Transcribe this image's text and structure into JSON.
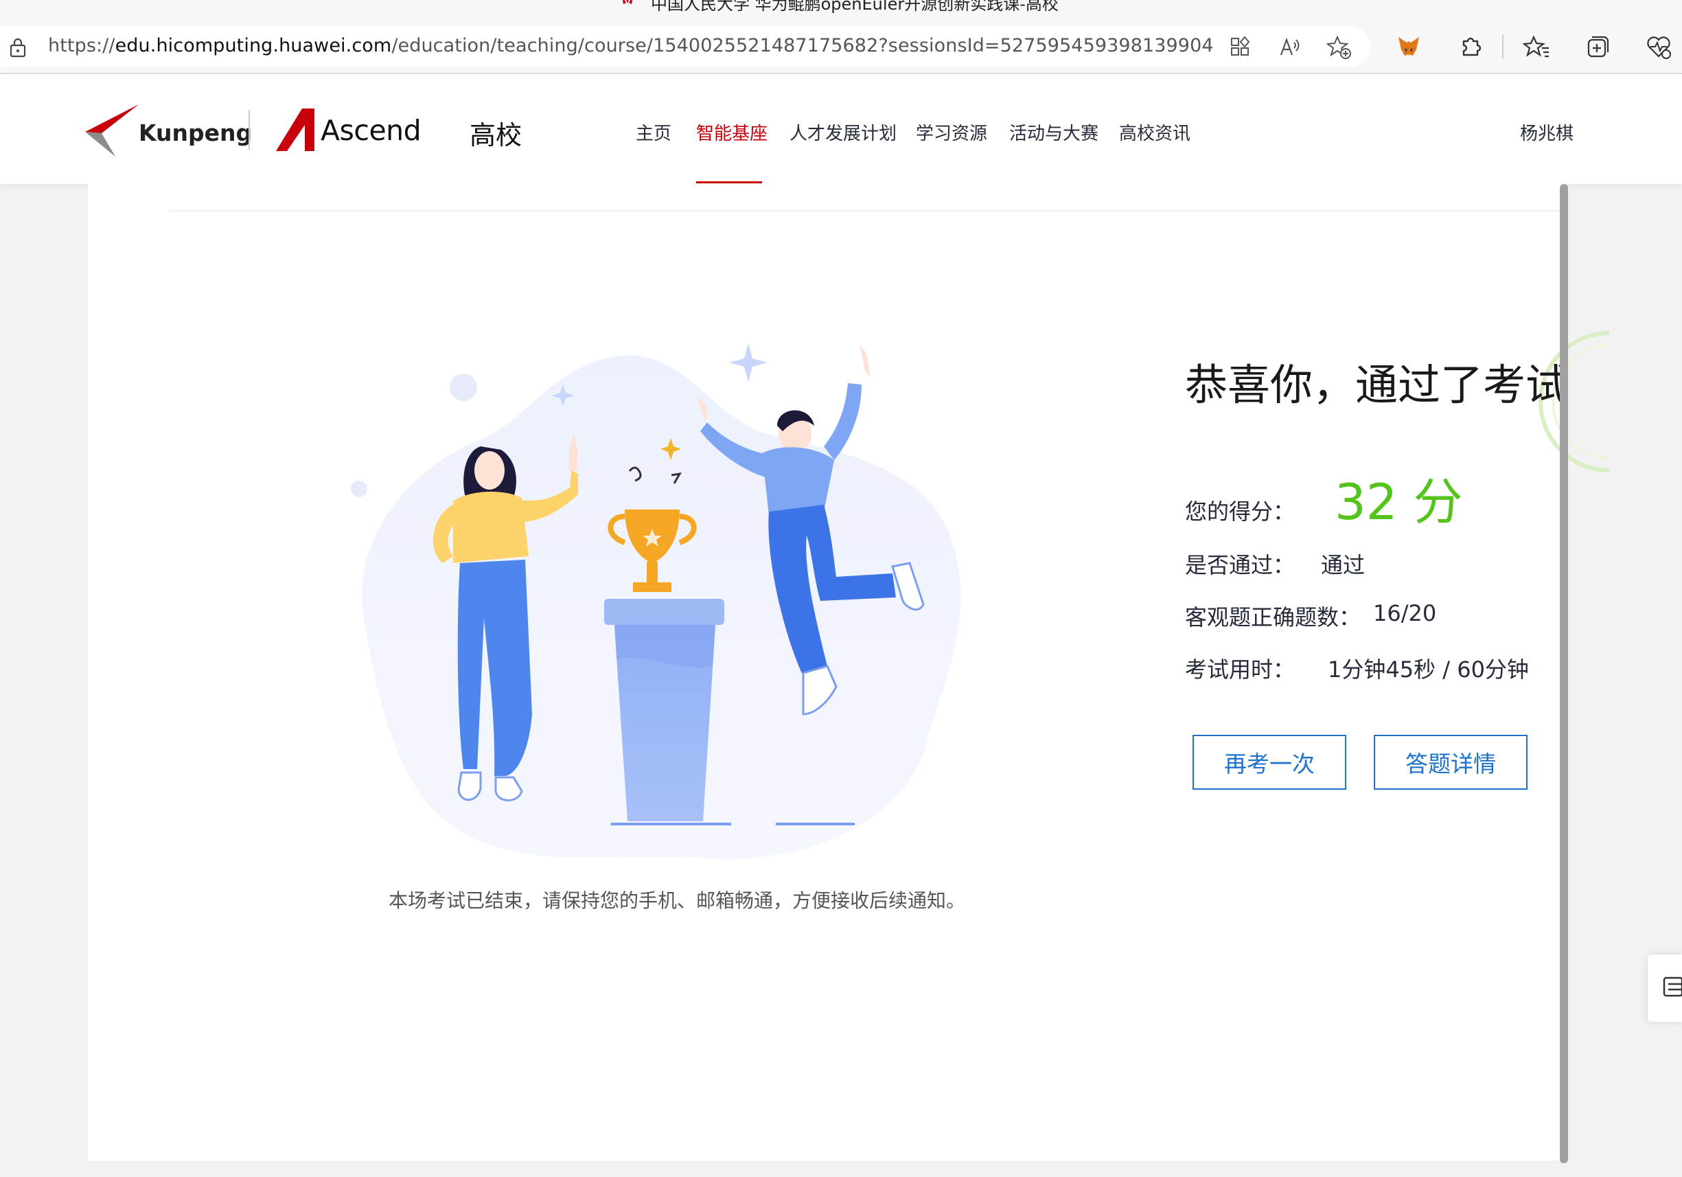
{
  "browser": {
    "tab_title": "中国人民大学 华为鲲鹏openEuler开源创新实践课-高校",
    "favicon_label": "HUAWEI",
    "url_scheme": "https://",
    "url_host": "edu.hicomputing.huawei.com",
    "url_path": "/education/teaching/course/1540025521487175682?sessionsId=527595459398139904",
    "toolbar_icons": [
      "apps-icon",
      "read-aloud-icon",
      "add-favorite-icon",
      "metamask-fox-icon",
      "extensions-puzzle-icon",
      "favorites-icon",
      "collections-icon",
      "browser-essentials-icon"
    ]
  },
  "header": {
    "logo1_text": "Kunpeng",
    "logo2_text": "Ascend",
    "site_name": "高校",
    "nav": [
      {
        "label": "主页",
        "active": false
      },
      {
        "label": "智能基座",
        "active": true
      },
      {
        "label": "人才发展计划",
        "active": false
      },
      {
        "label": "学习资源",
        "active": false
      },
      {
        "label": "活动与大赛",
        "active": false
      },
      {
        "label": "高校资讯",
        "active": false
      }
    ],
    "username": "杨兆棋",
    "brand_color": "#c7000b"
  },
  "result": {
    "heading": "恭喜你，通过了考试",
    "score_label": "您的得分：",
    "score_value": "32 分",
    "pass_label": "是否通过：",
    "pass_value": "通过",
    "correct_label": "客观题正确题数：",
    "correct_value": "16/20",
    "time_label": "考试用时：",
    "time_value": "1分钟45秒 / 60分钟",
    "score_color": "#52c41a",
    "buttons": {
      "retake": "再考一次",
      "details": "答题详情"
    },
    "notice": "本场考试已结束，请保持您的手机、邮箱畅通，方便接收后续通知。"
  }
}
